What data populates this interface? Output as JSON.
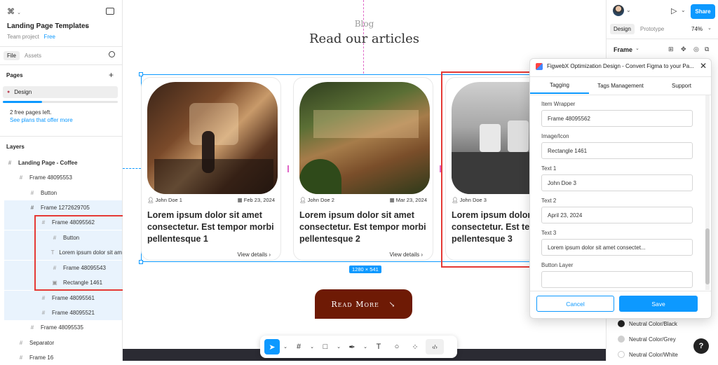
{
  "left": {
    "project": "Landing Page Templates",
    "team": "Team project",
    "plan": "Free",
    "tab_file": "File",
    "tab_assets": "Assets",
    "pages_label": "Pages",
    "page_name": "Design",
    "free_pages": "2 free pages left.",
    "see_plans": "See plans that offer more",
    "layers_label": "Layers",
    "layers": [
      {
        "name": "Landing Page - Coffee",
        "icon": "#"
      },
      {
        "name": "Frame 48095553",
        "icon": "#"
      },
      {
        "name": "Button",
        "icon": "#"
      },
      {
        "name": "Frame 1272629705",
        "icon": "#"
      },
      {
        "name": "Frame 48095562",
        "icon": "#"
      },
      {
        "name": "Button",
        "icon": "#"
      },
      {
        "name": "Lorem ipsum dolor sit am",
        "icon": "T"
      },
      {
        "name": "Frame 48095543",
        "icon": "#"
      },
      {
        "name": "Rectangle 1461",
        "icon": "▣"
      },
      {
        "name": "Frame 48095561",
        "icon": "#"
      },
      {
        "name": "Frame 48095521",
        "icon": "#"
      },
      {
        "name": "Frame 48095535",
        "icon": "#"
      },
      {
        "name": "Separator",
        "icon": "#"
      },
      {
        "name": "Frame 16",
        "icon": "#"
      }
    ]
  },
  "canvas": {
    "section_label": "Blog",
    "heading": "Read our articles",
    "size_badge": "1280 × 541",
    "read_more": "Read More",
    "cards": [
      {
        "author": "John Doe 1",
        "date": "Feb 23, 2024",
        "title": "Lorem ipsum dolor sit amet consectetur. Est tempor morbi pellentesque 1",
        "link": "View details"
      },
      {
        "author": "John Doe 2",
        "date": "Mar 23, 2024",
        "title": "Lorem ipsum dolor sit amet consectetur. Est tempor morbi pellentesque 2",
        "link": "View details"
      },
      {
        "author": "John Doe 3",
        "date": "",
        "title": "Lorem ipsum dolor sit amet consectetur. Est tempor morbi pellentesque 3",
        "link": ""
      }
    ]
  },
  "right": {
    "share": "Share",
    "tab_design": "Design",
    "tab_prototype": "Prototype",
    "zoom": "74%",
    "frame_label": "Frame",
    "colors": [
      {
        "name": "Neutral Color/Black",
        "hex": "#222222"
      },
      {
        "name": "Neutral Color/Grey",
        "hex": "#cfcfcf"
      },
      {
        "name": "Neutral Color/White",
        "hex": "#ffffff"
      }
    ],
    "help": "?"
  },
  "plugin": {
    "title": "FigwebX Optimization Design - Convert Figma to your Pa...",
    "tabs": [
      "Tagging",
      "Tags Management",
      "Support"
    ],
    "fields": [
      {
        "label": "Item Wrapper",
        "value": "Frame 48095562"
      },
      {
        "label": "Image/Icon",
        "value": "Rectangle 1461"
      },
      {
        "label": "Text 1",
        "value": "John Doe 3"
      },
      {
        "label": "Text 2",
        "value": "April 23, 2024"
      },
      {
        "label": "Text 3",
        "value": "Lorem ipsum dolor sit amet consectet..."
      },
      {
        "label": "Button Layer",
        "value": ""
      }
    ],
    "cancel": "Cancel",
    "save": "Save"
  },
  "colors": {
    "accent": "#0d99ff",
    "brown": "#6e1a05",
    "highlight": "#e53935"
  }
}
